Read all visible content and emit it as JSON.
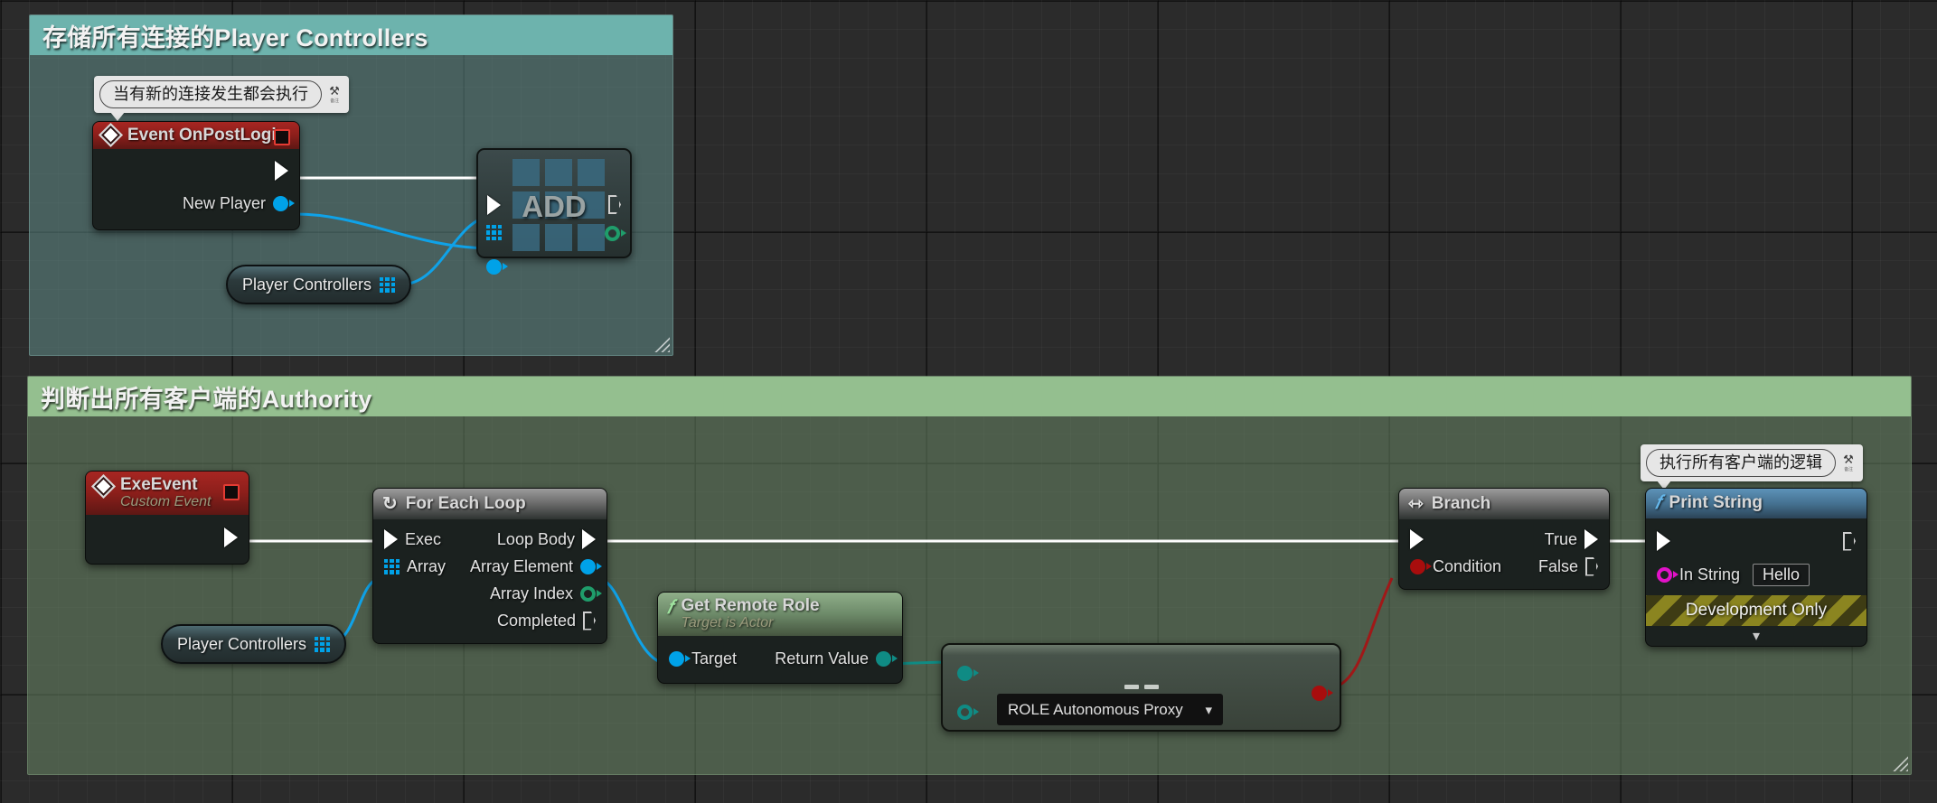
{
  "canvas": {
    "grid_color": "#2b2b2b",
    "accent_exec": "#ffffff"
  },
  "comments": [
    {
      "id": "comment-1",
      "title": "存储所有连接的Player Controllers",
      "header_color": "#6db3ad",
      "fill_color": "rgba(96,140,137,0.55)"
    },
    {
      "id": "comment-2",
      "title": "判断出所有客户端的Authority",
      "header_color": "#94bf8f",
      "fill_color": "rgba(105,134,102,0.55)"
    }
  ],
  "bubbles": [
    {
      "id": "bubble-1",
      "text": "当有新的连接发生都会执行",
      "pin_glyph": "⚒",
      "pin_sub": "备注"
    },
    {
      "id": "bubble-2",
      "text": "执行所有客户端的逻辑",
      "pin_glyph": "⚒",
      "pin_sub": "备注"
    }
  ],
  "nodes": {
    "event_onpostlogin": {
      "title": "Event OnPostLogin",
      "icon": "event-diamond-icon",
      "pins": {
        "exec_out": "",
        "new_player": "New Player"
      }
    },
    "add_node": {
      "label": "ADD",
      "icon": "grid-placeholder-icon"
    },
    "player_controllers_1": {
      "label": "Player Controllers",
      "pin_type": "array"
    },
    "exe_event": {
      "title": "ExeEvent",
      "subtitle": "Custom Event",
      "icon": "event-diamond-icon"
    },
    "for_each_loop": {
      "title": "For Each Loop",
      "icon": "loop-icon",
      "inputs": [
        "Exec",
        "Array"
      ],
      "outputs": [
        "Loop Body",
        "Array Element",
        "Array Index",
        "Completed"
      ]
    },
    "player_controllers_2": {
      "label": "Player Controllers",
      "pin_type": "array"
    },
    "get_remote_role": {
      "title": "Get Remote Role",
      "subtitle": "Target is Actor",
      "icon": "function-f-icon",
      "inputs": [
        "Target"
      ],
      "outputs": [
        "Return Value"
      ]
    },
    "equal_enum": {
      "operator": "==",
      "selected_option": "ROLE Autonomous Proxy",
      "options": [
        "ROLE Autonomous Proxy"
      ],
      "chevron": "chevron-down-icon"
    },
    "branch": {
      "title": "Branch",
      "icon": "branch-icon",
      "inputs": [
        "Condition"
      ],
      "outputs": [
        "True",
        "False"
      ]
    },
    "print_string": {
      "title": "Print String",
      "icon": "function-f-icon",
      "in_string_label": "In String",
      "in_string_value": "Hello",
      "development_only": "Development Only",
      "expander": "chevron-down-icon"
    }
  },
  "pin_colors": {
    "exec": "#ffffff",
    "object_blue": "#00a2e8",
    "array_blue": "#00a2e8",
    "boolean_red": "#a80d0d",
    "byte_enum_teal": "#0f8b84",
    "integer_green": "#1f9d6b",
    "string_magenta": "#e212c8"
  }
}
